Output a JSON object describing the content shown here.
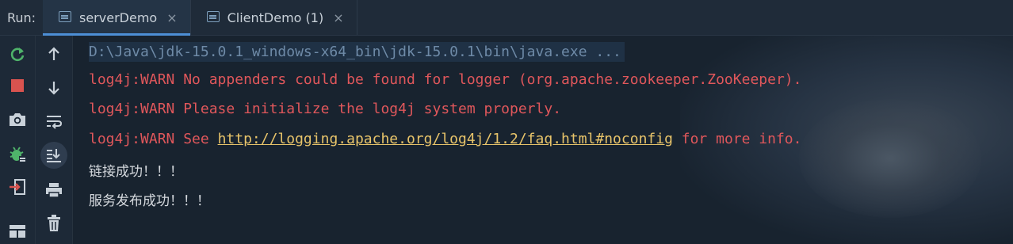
{
  "run_label": "Run:",
  "tabs": [
    {
      "label": "serverDemo",
      "close": "×"
    },
    {
      "label": "ClientDemo (1)",
      "close": "×"
    }
  ],
  "console": {
    "command": "D:\\Java\\jdk-15.0.1_windows-x64_bin\\jdk-15.0.1\\bin\\java.exe ...",
    "warn1": "log4j:WARN No appenders could be found for logger (org.apache.zookeeper.ZooKeeper).",
    "warn2": "log4j:WARN Please initialize the log4j system properly.",
    "warn3_prefix": "log4j:WARN See ",
    "warn3_link": "http://logging.apache.org/log4j/1.2/faq.html#noconfig",
    "warn3_suffix": " for more info.",
    "out1": "链接成功！！！",
    "out2": "服务发布成功！！！"
  },
  "colors": {
    "warn": "#e0575b",
    "link": "#e8c46a",
    "command": "#6e8aa7",
    "accent": "#4d8fd6"
  },
  "icons": {
    "gutter1": [
      "rerun-icon",
      "stop-icon",
      "camera-icon",
      "debug-icon",
      "exit-icon",
      "layout-icon"
    ],
    "gutter2": [
      "up-arrow-icon",
      "down-arrow-icon",
      "soft-wrap-icon",
      "scroll-to-end-icon",
      "print-icon",
      "trash-icon"
    ]
  }
}
